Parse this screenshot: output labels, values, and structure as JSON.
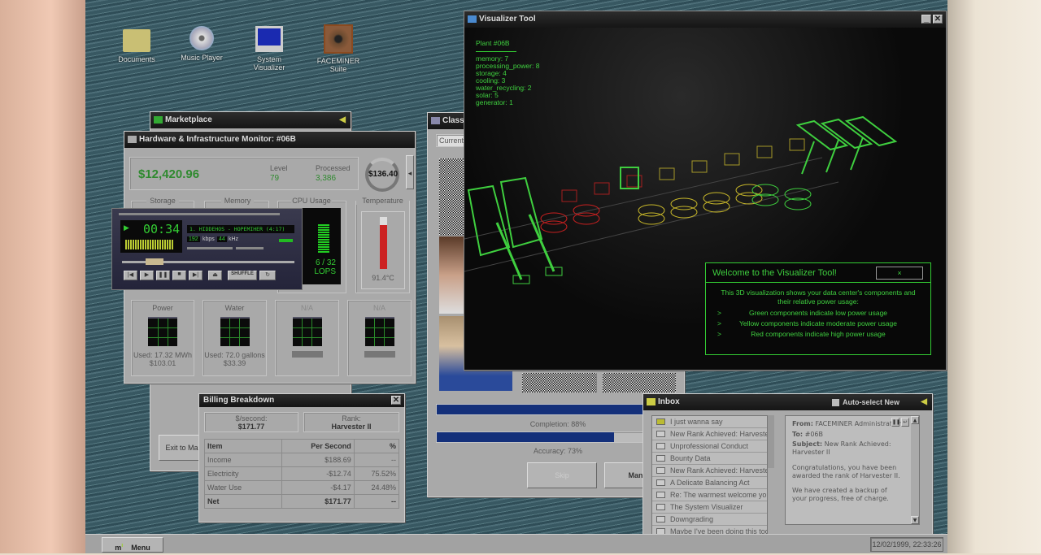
{
  "desktop": {
    "icons": [
      {
        "label": "Documents",
        "icon": "folder-icon"
      },
      {
        "label": "Music Player",
        "icon": "cd-music-icon"
      },
      {
        "label": "System Visualizer",
        "icon": "computer-icon"
      },
      {
        "label": "FACEMINER Suite",
        "icon": "eye-icon"
      }
    ]
  },
  "marketplace": {
    "title": "Marketplace",
    "exit_label": "Exit to Mar"
  },
  "monitor": {
    "title": "Hardware & Infrastructure Monitor: #06B",
    "balance": "$12,420.96",
    "level_label": "Level",
    "level": "79",
    "processed_label": "Processed",
    "processed": "3,386",
    "ring_value": "$136.40",
    "panels": {
      "storage": "Storage",
      "memory": "Memory",
      "cpu": "CPU Usage",
      "cpu_value": "6 / 32",
      "cpu_unit": "LOPS",
      "temperature": "Temperature",
      "temp_value": "91.4°C",
      "temp_fill": 0.85
    },
    "meters": [
      {
        "label": "Power",
        "used": "Used: 17.32 MWh",
        "cost": "$103.01"
      },
      {
        "label": "Water",
        "used": "Used: 72.0 gallons",
        "cost": "$33.39"
      },
      {
        "label": "N/A"
      },
      {
        "label": "N/A"
      }
    ]
  },
  "player": {
    "time": "00:34",
    "track": "1. HIDDEHOS - HOPEMIHER (4:17)",
    "kbps": "192",
    "kbps_label": "kbps",
    "khz": "44",
    "khz_label": "kHz",
    "shuffle": "SHUFFLE",
    "progress": 0.15
  },
  "billing": {
    "title": "Billing Breakdown",
    "rate_label": "$/second:",
    "rate": "$171.77",
    "rank_label": "Rank:",
    "rank": "Harvester II",
    "columns": [
      "Item",
      "Per Second",
      "%"
    ],
    "rows": [
      [
        "Income",
        "$188.69",
        "--"
      ],
      [
        "Electricity",
        "-$12.74",
        "75.52%"
      ],
      [
        "Water Use",
        "-$4.17",
        "24.48%"
      ],
      [
        "Net",
        "$171.77",
        "--"
      ]
    ]
  },
  "classifier": {
    "title": "Classi",
    "tab": "Current I",
    "completion": "Completion: 88%",
    "completion_value": 0.88,
    "accuracy": "Accuracy: 73%",
    "accuracy_value": 0.73,
    "skip": "Skip",
    "manual": "Manual"
  },
  "visualizer": {
    "title": "Visualizer Tool",
    "plant": "Plant #06B",
    "stats": [
      "memory: 7",
      "processing_power: 8",
      "storage: 4",
      "cooling: 3",
      "water_recycling: 2",
      "solar: 5",
      "generator: 1"
    ],
    "welcome": {
      "title": "Welcome to the Visualizer Tool!",
      "close": "×",
      "intro": "This 3D visualization shows your data center's components and their relative power usage:",
      "items": [
        "Green components indicate low power usage",
        "Yellow components indicate moderate power usage",
        "Red components indicate high power usage"
      ],
      "bullet": ">"
    },
    "colors": {
      "low": "#3fcf3f",
      "moderate": "#c8b82a",
      "high": "#c82020"
    }
  },
  "inbox": {
    "title": "Inbox",
    "auto_select": "Auto-select New",
    "messages": [
      "I just wanna say",
      "New Rank Achieved: Harveste...",
      "Unprofessional Conduct",
      "Bounty Data",
      "New Rank Achieved: Harvester I",
      "A Delicate Balancing Act",
      "Re: The warmest welcome you'...",
      "The System Visualizer",
      "Downgrading",
      "Maybe I've been doing this too l..."
    ],
    "from_label": "From:",
    "from": "FACEMINER Administration",
    "to_label": "To:",
    "to": "#06B",
    "subject_label": "Subject:",
    "subject": "New Rank Achieved: Harvester II",
    "body1": "Congratulations, you have been awarded the rank of Harvester II.",
    "body2": "We have created a backup of your progress, free of charge."
  },
  "taskbar": {
    "menu": "Menu",
    "clock": "12/02/1999, 22:33:26"
  }
}
